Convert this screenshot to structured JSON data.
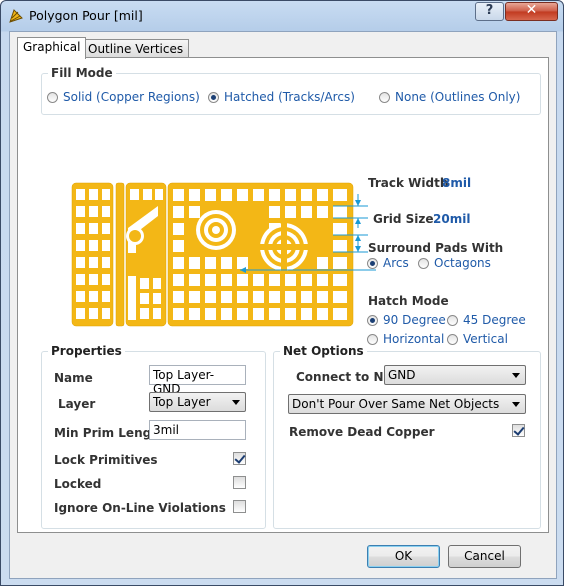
{
  "window": {
    "title": "Polygon Pour [mil]",
    "help_label": "?",
    "close_label": "✕"
  },
  "tabs": [
    {
      "label": "Graphical",
      "active": true
    },
    {
      "label": "Outline Vertices",
      "active": false
    }
  ],
  "fill_mode": {
    "title": "Fill Mode",
    "options": [
      {
        "label": "Solid (Copper Regions)",
        "selected": false
      },
      {
        "label": "Hatched (Tracks/Arcs)",
        "selected": true
      },
      {
        "label": "None (Outlines Only)",
        "selected": false
      }
    ]
  },
  "hatch_settings": {
    "track_width_label": "Track Width",
    "track_width_value": "8mil",
    "grid_size_label": "Grid Size",
    "grid_size_value": "20mil",
    "surround_label": "Surround Pads With",
    "surround_options": [
      {
        "label": "Arcs",
        "selected": true
      },
      {
        "label": "Octagons",
        "selected": false
      }
    ],
    "hatch_mode_label": "Hatch Mode",
    "hatch_mode_options": [
      {
        "label": "90 Degree",
        "selected": true
      },
      {
        "label": "45 Degree",
        "selected": false
      },
      {
        "label": "Horizontal",
        "selected": false
      },
      {
        "label": "Vertical",
        "selected": false
      }
    ]
  },
  "properties": {
    "title": "Properties",
    "name_label": "Name",
    "name_value": "Top Layer-GND",
    "layer_label": "Layer",
    "layer_value": "Top Layer",
    "min_prim_label": "Min Prim Length",
    "min_prim_value": "3mil",
    "lock_primitives_label": "Lock Primitives",
    "lock_primitives_checked": true,
    "locked_label": "Locked",
    "locked_checked": false,
    "ignore_label": "Ignore On-Line Violations",
    "ignore_checked": false
  },
  "net_options": {
    "title": "Net Options",
    "connect_label": "Connect to Net",
    "connect_value": "GND",
    "pour_value": "Don't Pour Over Same Net Objects",
    "remove_dead_label": "Remove Dead Copper",
    "remove_dead_checked": true
  },
  "buttons": {
    "ok": "OK",
    "cancel": "Cancel"
  },
  "colors": {
    "copper": "#f3b716",
    "accent_text": "#1f5aa8",
    "dimension_line": "#1a9ad6"
  }
}
